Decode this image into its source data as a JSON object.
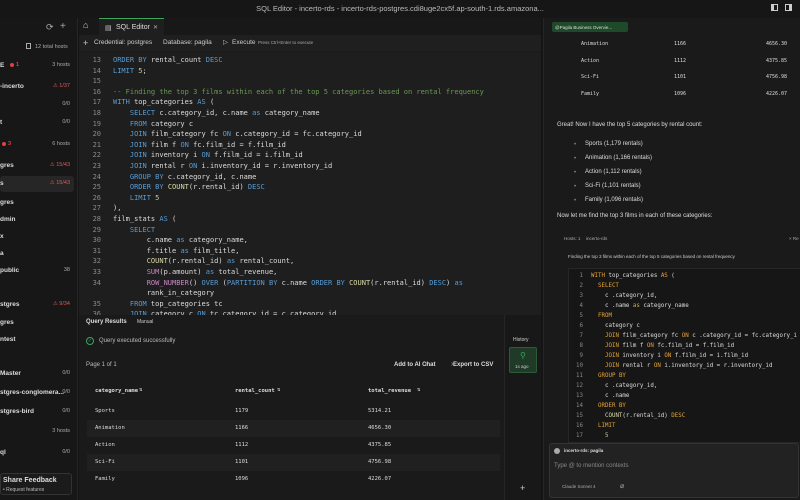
{
  "window_title": "SQL Editor - incerto-rds - incerto-rds-postgres.cdi8uge2cx5f.ap-south-1.rds.amazona...",
  "sidebar": {
    "total_hosts": "12 total hosts",
    "items": [
      {
        "label": "E",
        "dot": "1",
        "right": "3 hosts",
        "warn": false
      },
      {
        "label": "-incerto",
        "right": "1/37",
        "warn": true
      },
      {
        "label": "",
        "right": "0/0",
        "warn": false
      },
      {
        "label": "t",
        "right": "0/0",
        "warn": false
      },
      {
        "label": "",
        "dot": "3",
        "right": "6 hosts",
        "warn": false
      },
      {
        "label": "gres",
        "right": "15/43",
        "warn": true
      },
      {
        "label": "s",
        "right": "15/43",
        "warn": true,
        "selected": true
      },
      {
        "label": "gres",
        "right": ""
      },
      {
        "label": "dmin",
        "right": ""
      },
      {
        "label": "x",
        "right": ""
      },
      {
        "label": "a",
        "right": ""
      },
      {
        "label": "public",
        "right": "38"
      },
      {
        "label": "",
        "right": ""
      },
      {
        "label": "stgres",
        "right": "9/34",
        "warn": true
      },
      {
        "label": "gres",
        "right": ""
      },
      {
        "label": "ntest",
        "right": ""
      },
      {
        "label": "",
        "right": ""
      },
      {
        "label": "Master",
        "right": "0/0"
      },
      {
        "label": "stgres-conglomera...",
        "right": "0/0"
      },
      {
        "label": "stgres-bird",
        "right": "0/0"
      },
      {
        "label": "",
        "right": "3 hosts"
      },
      {
        "label": "ql",
        "right": "0/0"
      }
    ],
    "feedback_title": "Share Feedback",
    "feedback_sub": "• Request features"
  },
  "tabs": {
    "active": "SQL Editor"
  },
  "toolbar": {
    "credential": "Credential: postgres",
    "database": "Database: pagila",
    "execute": "Execute",
    "hint": "Press Ctrl+Enter to execute"
  },
  "code_lines": [
    {
      "n": "13",
      "t": "ORDER BY rental_count DESC"
    },
    {
      "n": "14",
      "t": "LIMIT 5;"
    },
    {
      "n": "15",
      "t": ""
    },
    {
      "n": "16",
      "t": "-- Finding the top 3 films within each of the top 5 categories based on rental frequency"
    },
    {
      "n": "17",
      "t": "WITH top_categories AS ("
    },
    {
      "n": "18",
      "t": "    SELECT c.category_id, c.name as category_name"
    },
    {
      "n": "19",
      "t": "    FROM category c"
    },
    {
      "n": "20",
      "t": "    JOIN film_category fc ON c.category_id = fc.category_id"
    },
    {
      "n": "21",
      "t": "    JOIN film f ON fc.film_id = f.film_id"
    },
    {
      "n": "22",
      "t": "    JOIN inventory i ON f.film_id = i.film_id"
    },
    {
      "n": "23",
      "t": "    JOIN rental r ON i.inventory_id = r.inventory_id"
    },
    {
      "n": "24",
      "t": "    GROUP BY c.category_id, c.name"
    },
    {
      "n": "25",
      "t": "    ORDER BY COUNT(r.rental_id) DESC"
    },
    {
      "n": "26",
      "t": "    LIMIT 5"
    },
    {
      "n": "27",
      "t": "),"
    },
    {
      "n": "28",
      "t": "film_stats AS ("
    },
    {
      "n": "29",
      "t": "    SELECT"
    },
    {
      "n": "30",
      "t": "        c.name as category_name,"
    },
    {
      "n": "31",
      "t": "        f.title as film_title,"
    },
    {
      "n": "32",
      "t": "        COUNT(r.rental_id) as rental_count,"
    },
    {
      "n": "33",
      "t": "        SUM(p.amount) as total_revenue,"
    },
    {
      "n": "34",
      "t": "        ROW_NUMBER() OVER (PARTITION BY c.name ORDER BY COUNT(r.rental_id) DESC) as"
    },
    {
      "n": "",
      "t": "        rank_in_category"
    },
    {
      "n": "35",
      "t": "    FROM top_categories tc"
    },
    {
      "n": "36",
      "t": "    JOIN category c ON tc.category_id = c.category_id"
    }
  ],
  "results": {
    "tab": "Query Results",
    "mode": "Manual",
    "status": "Query executed successfully",
    "page": "Page 1 of 1",
    "add_ai": "Add to AI Chat",
    "export": "Export to CSV",
    "columns": [
      "category_name",
      "rental_count",
      "total_revenue"
    ],
    "rows": [
      [
        "Sports",
        "1179",
        "5314.21"
      ],
      [
        "Animation",
        "1166",
        "4656.30"
      ],
      [
        "Action",
        "1112",
        "4375.85"
      ],
      [
        "Sci-Fi",
        "1101",
        "4756.98"
      ],
      [
        "Family",
        "1096",
        "4226.07"
      ]
    ]
  },
  "history": {
    "label": "History",
    "time": "1s ago"
  },
  "chat": {
    "context_chip": "@Pagila Business Overvie...",
    "top_rows": [
      [
        "Animation",
        "1166",
        "4656.30"
      ],
      [
        "Action",
        "1112",
        "4375.85"
      ],
      [
        "Sci-Fi",
        "1101",
        "4756.98"
      ],
      [
        "Family",
        "1096",
        "4226.07"
      ]
    ],
    "msg1": "Great! Now I have the top 5 categories by rental count:",
    "bullets": [
      "Sports (1,179 rentals)",
      "Animation (1,166 rentals)",
      "Action (1,112 rentals)",
      "Sci-Fi (1,101 rentals)",
      "Family (1,096 rentals)"
    ],
    "msg2": "Now let me find the top 3 films in each of these categories:",
    "hosts": "Hosts: 1",
    "host_sel": "incerto-rds",
    "right_btn": "× Re",
    "query_title": "Finding the top 3 films within each of the top 5 categories based on rental frequency",
    "code": [
      {
        "n": "1",
        "t": "WITH top_categories AS ("
      },
      {
        "n": "2",
        "t": "  SELECT"
      },
      {
        "n": "3",
        "t": "    c .category_id,"
      },
      {
        "n": "4",
        "t": "    c .name as category_name"
      },
      {
        "n": "5",
        "t": "  FROM"
      },
      {
        "n": "6",
        "t": "    category c"
      },
      {
        "n": "7",
        "t": "    JOIN film_category fc ON c .category_id = fc.category_i"
      },
      {
        "n": "8",
        "t": "    JOIN film f ON fc.film_id = f.film_id"
      },
      {
        "n": "9",
        "t": "    JOIN inventory i ON f.film_id = i.film_id"
      },
      {
        "n": "10",
        "t": "    JOIN rental r ON i.inventory_id = r.inventory_id"
      },
      {
        "n": "11",
        "t": "  GROUP BY"
      },
      {
        "n": "12",
        "t": "    c .category_id,"
      },
      {
        "n": "13",
        "t": "    c .name"
      },
      {
        "n": "14",
        "t": "  ORDER BY"
      },
      {
        "n": "15",
        "t": "    COUNT(r.rental_id) DESC"
      },
      {
        "n": "16",
        "t": "  LIMIT"
      },
      {
        "n": "17",
        "t": "    5"
      }
    ],
    "input_context": "incerto-rds: pagila",
    "input_placeholder": "Type @ to mention contexts",
    "model": "Claude Sonnet 4"
  }
}
